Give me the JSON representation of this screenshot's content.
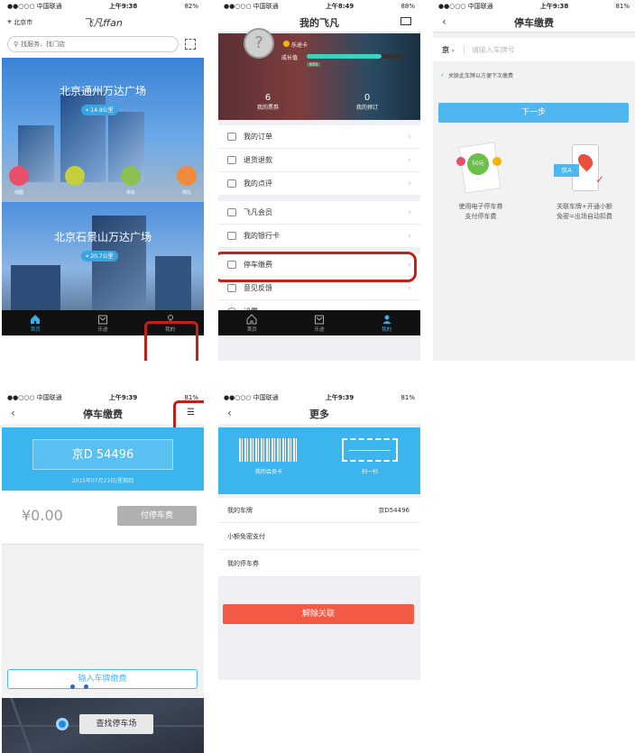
{
  "s1": {
    "status": {
      "carrier": "●●○○○ 中国联通",
      "time": "上午9:38",
      "battery": "82%"
    },
    "city": "北京市",
    "logo": "飞凡ffan",
    "search_placeholder": "找服务、找门店",
    "plaza1": {
      "name": "北京通州万达广场",
      "distance": "14.9公里"
    },
    "plaza2": {
      "name": "北京石景山万达广场",
      "distance": "20.7公里"
    },
    "quick": [
      "地图",
      "停车",
      "排队"
    ],
    "tabs": [
      "首页",
      "乐途",
      "我的"
    ]
  },
  "s2": {
    "status": {
      "carrier": "●●○○○ 中国联通",
      "time": "上午8:49",
      "battery": "88%"
    },
    "title": "我的飞凡",
    "profile": {
      "tag": "乐途卡",
      "growth": "成长值",
      "vip": "9/50"
    },
    "stats": [
      {
        "num": "6",
        "label": "我的票券"
      },
      {
        "num": "0",
        "label": "我的预订"
      }
    ],
    "menu1": [
      "我的订单",
      "退货退款",
      "我的点评"
    ],
    "menu2": [
      "飞凡会员",
      "我的银行卡"
    ],
    "menu3": [
      "停车缴费",
      "意见反馈",
      "设置"
    ],
    "tabs": [
      "首页",
      "乐途",
      "我的"
    ]
  },
  "s3": {
    "status": {
      "carrier": "●●○○○ 中国联通",
      "time": "上午9:38",
      "battery": "81%"
    },
    "title": "停车缴费",
    "province": "京",
    "plate_placeholder": "请输入车牌号",
    "remember": "关联此车牌以方便下次缴费",
    "next": "下一步",
    "coupon": "50元",
    "plate_badge": "京A",
    "feature1": [
      "使用电子停车券",
      "支付停车费"
    ],
    "feature2": [
      "关联车牌+开通小额",
      "免密=出场自动扣费"
    ]
  },
  "s4": {
    "status": {
      "carrier": "●●○○○ 中国联通",
      "time": "上午9:39",
      "battery": "81%"
    },
    "title": "停车缴费",
    "menu_icon": "☰",
    "plate": "京D  54496",
    "date": "2015年07月23日/星期四",
    "amount": "¥0.00",
    "pay": "付停车费",
    "input_plate": "输入车牌缴费",
    "find": "查找停车场"
  },
  "s5": {
    "status": {
      "carrier": "●●○○○ 中国联通",
      "time": "上午9:39",
      "battery": "81%"
    },
    "title": "更多",
    "card": "我的会员卡",
    "scan": "扫一扫",
    "rows": [
      {
        "label": "我的车牌",
        "value": "京D54496"
      },
      {
        "label": "小额免密支付",
        "value": ""
      },
      {
        "label": "我的停车券",
        "value": ""
      }
    ],
    "unlink": "解除关联"
  }
}
